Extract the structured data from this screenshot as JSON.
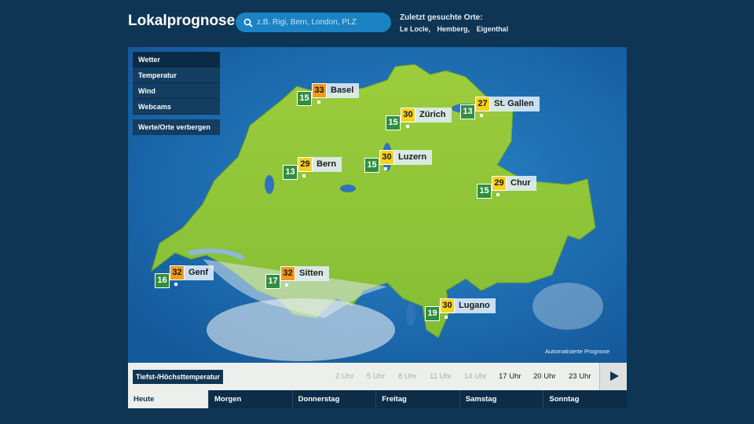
{
  "header": {
    "title": "Lokalprognose",
    "search_placeholder": "z.B. Rigi, Bern, London, PLZ",
    "recent_label": "Zuletzt gesuchte Orte:",
    "recent_places": [
      "Le Locle,",
      "Hemberg,",
      "Eigenthal"
    ]
  },
  "menu": {
    "items": [
      "Wetter",
      "Temperatur",
      "Wind",
      "Webcams"
    ],
    "active": "Wetter",
    "hide_label": "Werte/Orte verbergen"
  },
  "cities": [
    {
      "name": "Basel",
      "min": "15",
      "max": "33",
      "max_color": "orange"
    },
    {
      "name": "Zürich",
      "min": "15",
      "max": "30",
      "max_color": "yellow"
    },
    {
      "name": "St. Gallen",
      "min": "13",
      "max": "27",
      "max_color": "yellow"
    },
    {
      "name": "Bern",
      "min": "13",
      "max": "29",
      "max_color": "yellow"
    },
    {
      "name": "Luzern",
      "min": "15",
      "max": "30",
      "max_color": "yellow"
    },
    {
      "name": "Chur",
      "min": "15",
      "max": "29",
      "max_color": "yellow"
    },
    {
      "name": "Genf",
      "min": "16",
      "max": "32",
      "max_color": "orange"
    },
    {
      "name": "Sitten",
      "min": "17",
      "max": "32",
      "max_color": "orange"
    },
    {
      "name": "Lugano",
      "min": "19",
      "max": "30",
      "max_color": "yellow"
    }
  ],
  "map_note": "Automatisierte Prognose",
  "timebar": {
    "label": "Tiefst-/Höchsttemperatur",
    "hours": [
      "2 Uhr",
      "5 Uhr",
      "8 Uhr",
      "11 Uhr",
      "14 Uhr",
      "17 Uhr",
      "20 Uhr",
      "23 Uhr"
    ],
    "active_hours": [
      "17 Uhr",
      "20 Uhr",
      "23 Uhr"
    ]
  },
  "days": [
    "Heute",
    "Morgen",
    "Donnerstag",
    "Freitag",
    "Samstag",
    "Sonntag"
  ],
  "active_day": "Heute",
  "colors": {
    "background": "#0f3554",
    "search": "#1b82c4",
    "land": "#8cc63f",
    "water": "#1a6db6",
    "min_box": "#2f8e3f",
    "max_orange": "#f39a1e",
    "max_yellow": "#f8d21f"
  }
}
